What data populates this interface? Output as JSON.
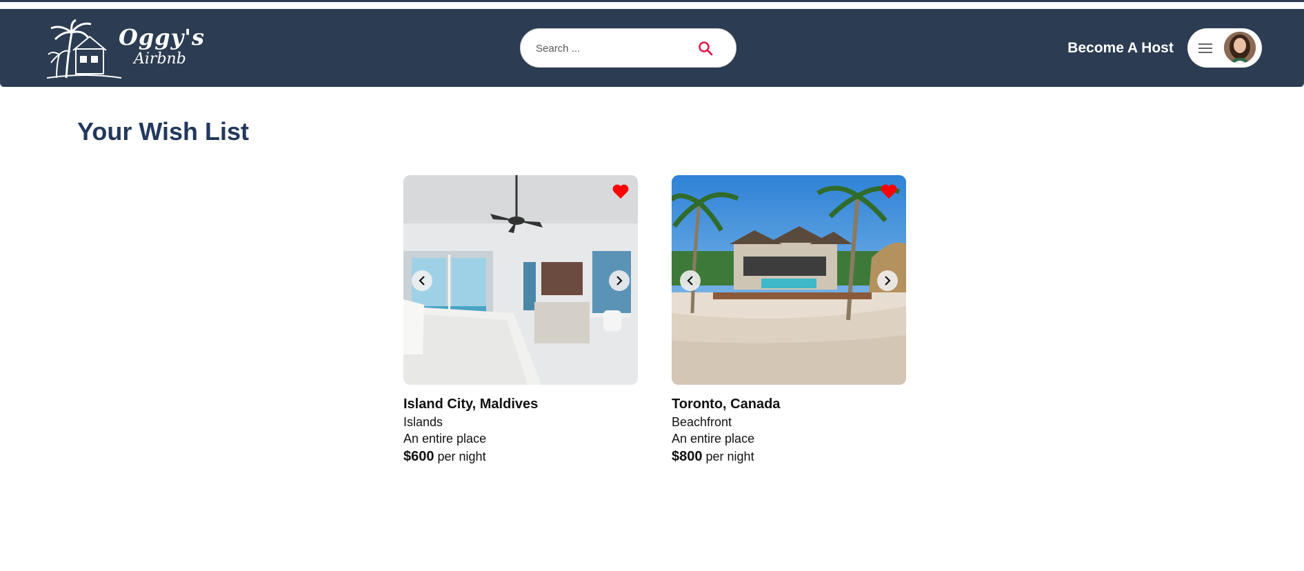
{
  "header": {
    "logo": {
      "line1": "Oggy's",
      "line2": "Airbnb"
    },
    "search": {
      "placeholder": "Search ...",
      "value": "",
      "icon": "search-icon",
      "icon_color": "#e11d48"
    },
    "become_host_label": "Become A Host",
    "user_menu": {
      "menu_icon": "menu-icon",
      "avatar": "avatar"
    },
    "background_color": "#2c3c52"
  },
  "main": {
    "title": "Your Wish List",
    "title_color": "#23385c",
    "listings": [
      {
        "location": "Island City, Maldives",
        "category": "Islands",
        "place_type": "An entire place",
        "price": "$600",
        "price_unit": "per night",
        "favorited": true
      },
      {
        "location": "Toronto, Canada",
        "category": "Beachfront",
        "place_type": "An entire place",
        "price": "$800",
        "price_unit": "per night",
        "favorited": true
      }
    ]
  },
  "colors": {
    "heart": "#ff0000"
  }
}
